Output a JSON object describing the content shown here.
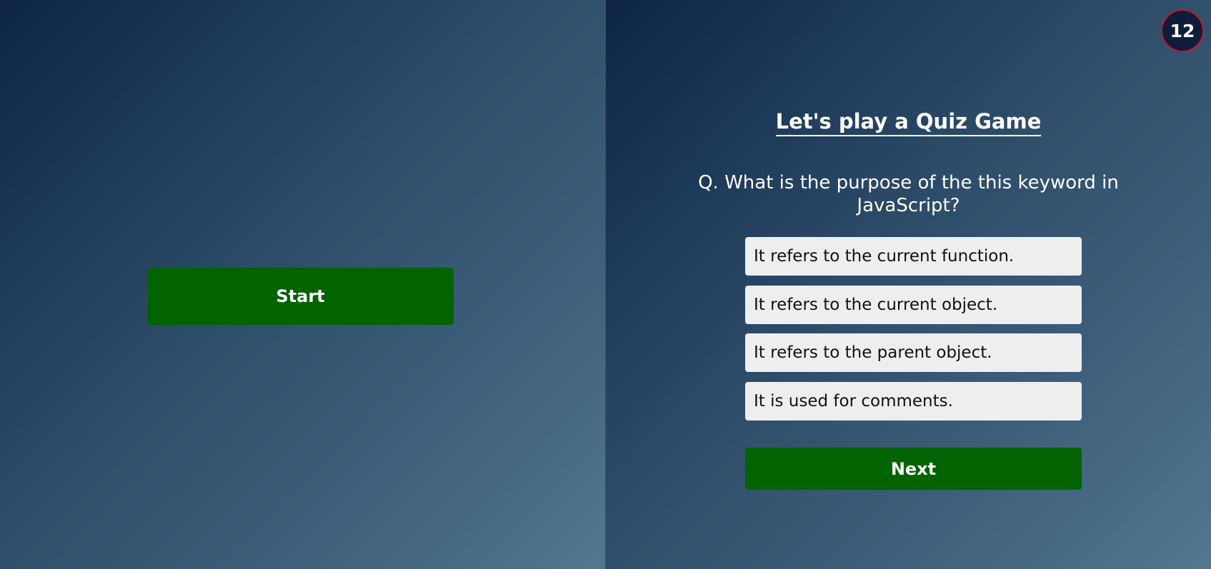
{
  "start_screen": {
    "start_label": "Start"
  },
  "quiz": {
    "timer": "12",
    "title": "Let's play a Quiz Game",
    "question": "Q. What is the purpose of the this keyword in JavaScript?",
    "options": [
      "It refers to the current function.",
      "It refers to the current object.",
      "It refers to the parent object.",
      "It is used for comments."
    ],
    "next_label": "Next"
  },
  "colors": {
    "button_green": "#026301",
    "timer_border": "#c21a2a",
    "timer_fill": "#0f1d3b",
    "option_bg": "#eeeeee"
  }
}
